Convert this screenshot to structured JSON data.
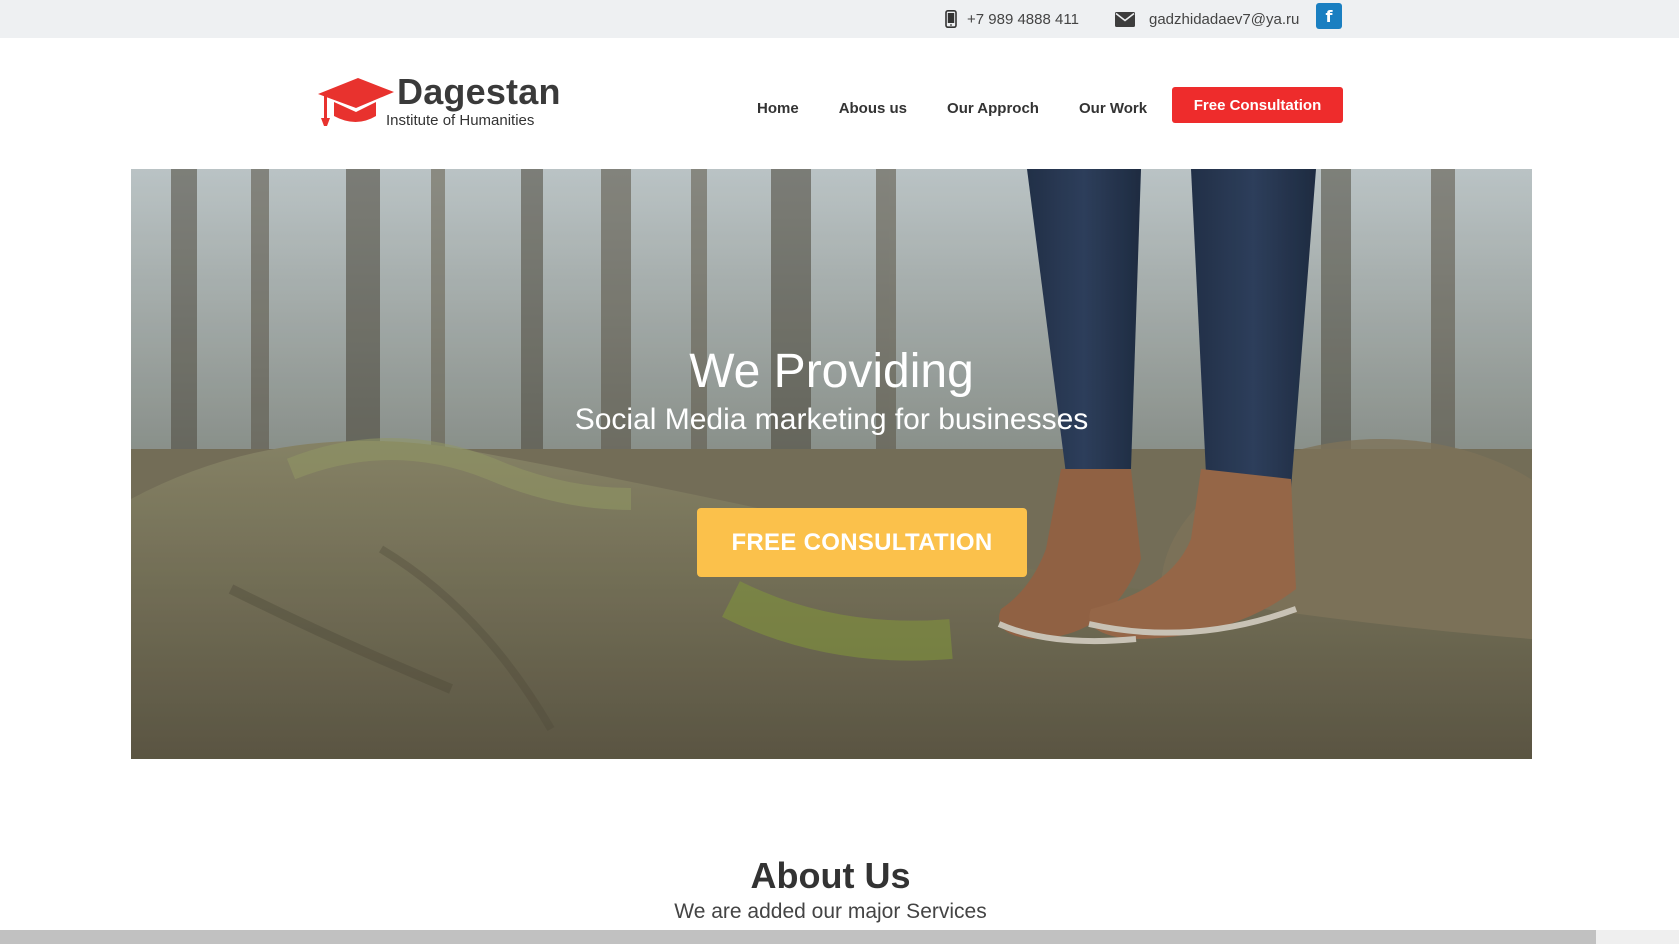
{
  "topbar": {
    "phone_icon": "mobile-phone-icon",
    "phone": "+7 989 4888 411",
    "email_icon": "envelope-icon",
    "email": "gadzhidadaev7@ya.ru",
    "facebook_icon": "facebook-icon",
    "facebook_glyph": "f"
  },
  "brand": {
    "logo_icon": "graduation-cap-icon",
    "name": "Dagestan",
    "tagline": "Institute of Humanities",
    "accent_color": "#e8322e"
  },
  "nav": {
    "items": [
      {
        "label": "Home"
      },
      {
        "label": "Abous us"
      },
      {
        "label": "Our Approch"
      },
      {
        "label": "Our Work"
      }
    ],
    "cta_label": "Free Consultation",
    "cta_color": "#ee2c2c"
  },
  "hero": {
    "title": "We Providing",
    "subtitle": "Social Media marketing for businesses",
    "cta_label": "FREE CONSULTATION",
    "cta_color": "#fbc14b"
  },
  "about": {
    "title": "About Us",
    "subtitle": "We are added our major Services"
  }
}
